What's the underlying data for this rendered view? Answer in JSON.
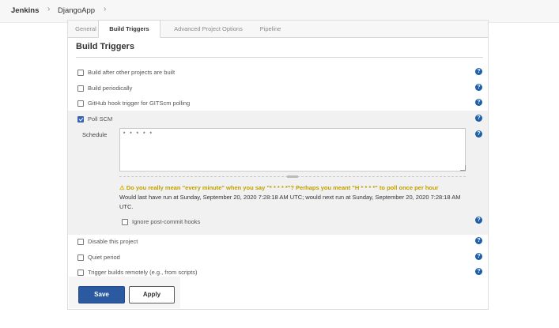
{
  "breadcrumb": {
    "items": [
      "Jenkins",
      "DjangoApp"
    ],
    "separator": "›"
  },
  "tabs": [
    {
      "label": "General",
      "active": false
    },
    {
      "label": "Build Triggers",
      "active": true
    },
    {
      "label": "Advanced Project Options",
      "active": false
    },
    {
      "label": "Pipeline",
      "active": false
    }
  ],
  "section": {
    "title": "Build Triggers",
    "triggers": [
      {
        "label": "Build after other projects are built",
        "checked": false
      },
      {
        "label": "Build periodically",
        "checked": false
      },
      {
        "label": "GitHub hook trigger for GITScm polling",
        "checked": false
      },
      {
        "label": "Poll SCM",
        "checked": true
      }
    ],
    "poll_scm": {
      "schedule_label": "Schedule",
      "schedule_value": "* * * * *",
      "warning": "Do you really mean \"every minute\" when you say \"* * * * *\"? Perhaps you meant \"H * * * *\" to poll once per hour",
      "run_info": "Would last have run at Sunday, September 20, 2020 7:28:18 AM UTC; would next run at Sunday, September 20, 2020 7:28:18 AM UTC.",
      "ignore_hooks_label": "Ignore post-commit hooks",
      "ignore_hooks_checked": false
    },
    "extra_options": [
      {
        "label": "Disable this project",
        "checked": false
      },
      {
        "label": "Quiet period",
        "checked": false
      },
      {
        "label": "Trigger builds remotely (e.g., from scripts)",
        "checked": false
      }
    ]
  },
  "help_icon_glyph": "?",
  "warning_icon_glyph": "⚠",
  "buttons": {
    "save": "Save",
    "apply": "Apply"
  },
  "colors": {
    "primary": "#2c5aa0",
    "help": "#1d5fa8",
    "warning": "#c0a000"
  }
}
